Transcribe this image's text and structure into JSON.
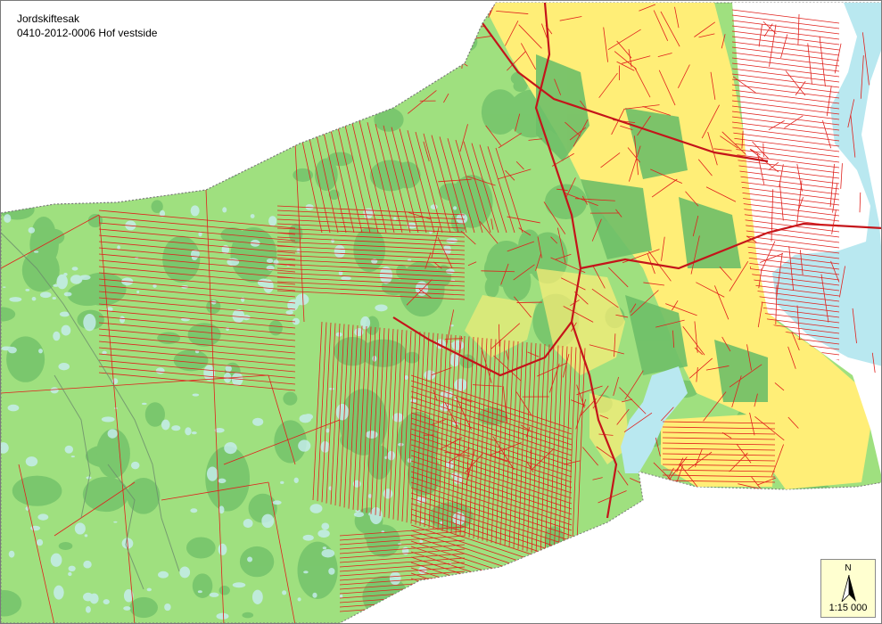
{
  "title": {
    "line1": "Jordskiftesak",
    "line2": "0410-2012-0006 Hof vestside"
  },
  "north_arrow": {
    "label": "N"
  },
  "scale": {
    "text": "1:15 000"
  },
  "colors": {
    "forest": "#9fe07f",
    "forest_dark": "#6ebf68",
    "farmland": "#ffee77",
    "water": "#c8eef2",
    "lake": "#b9e8f0",
    "boundary": "#e0201c",
    "outline": "#7a7a7a",
    "background": "#ffffff"
  }
}
